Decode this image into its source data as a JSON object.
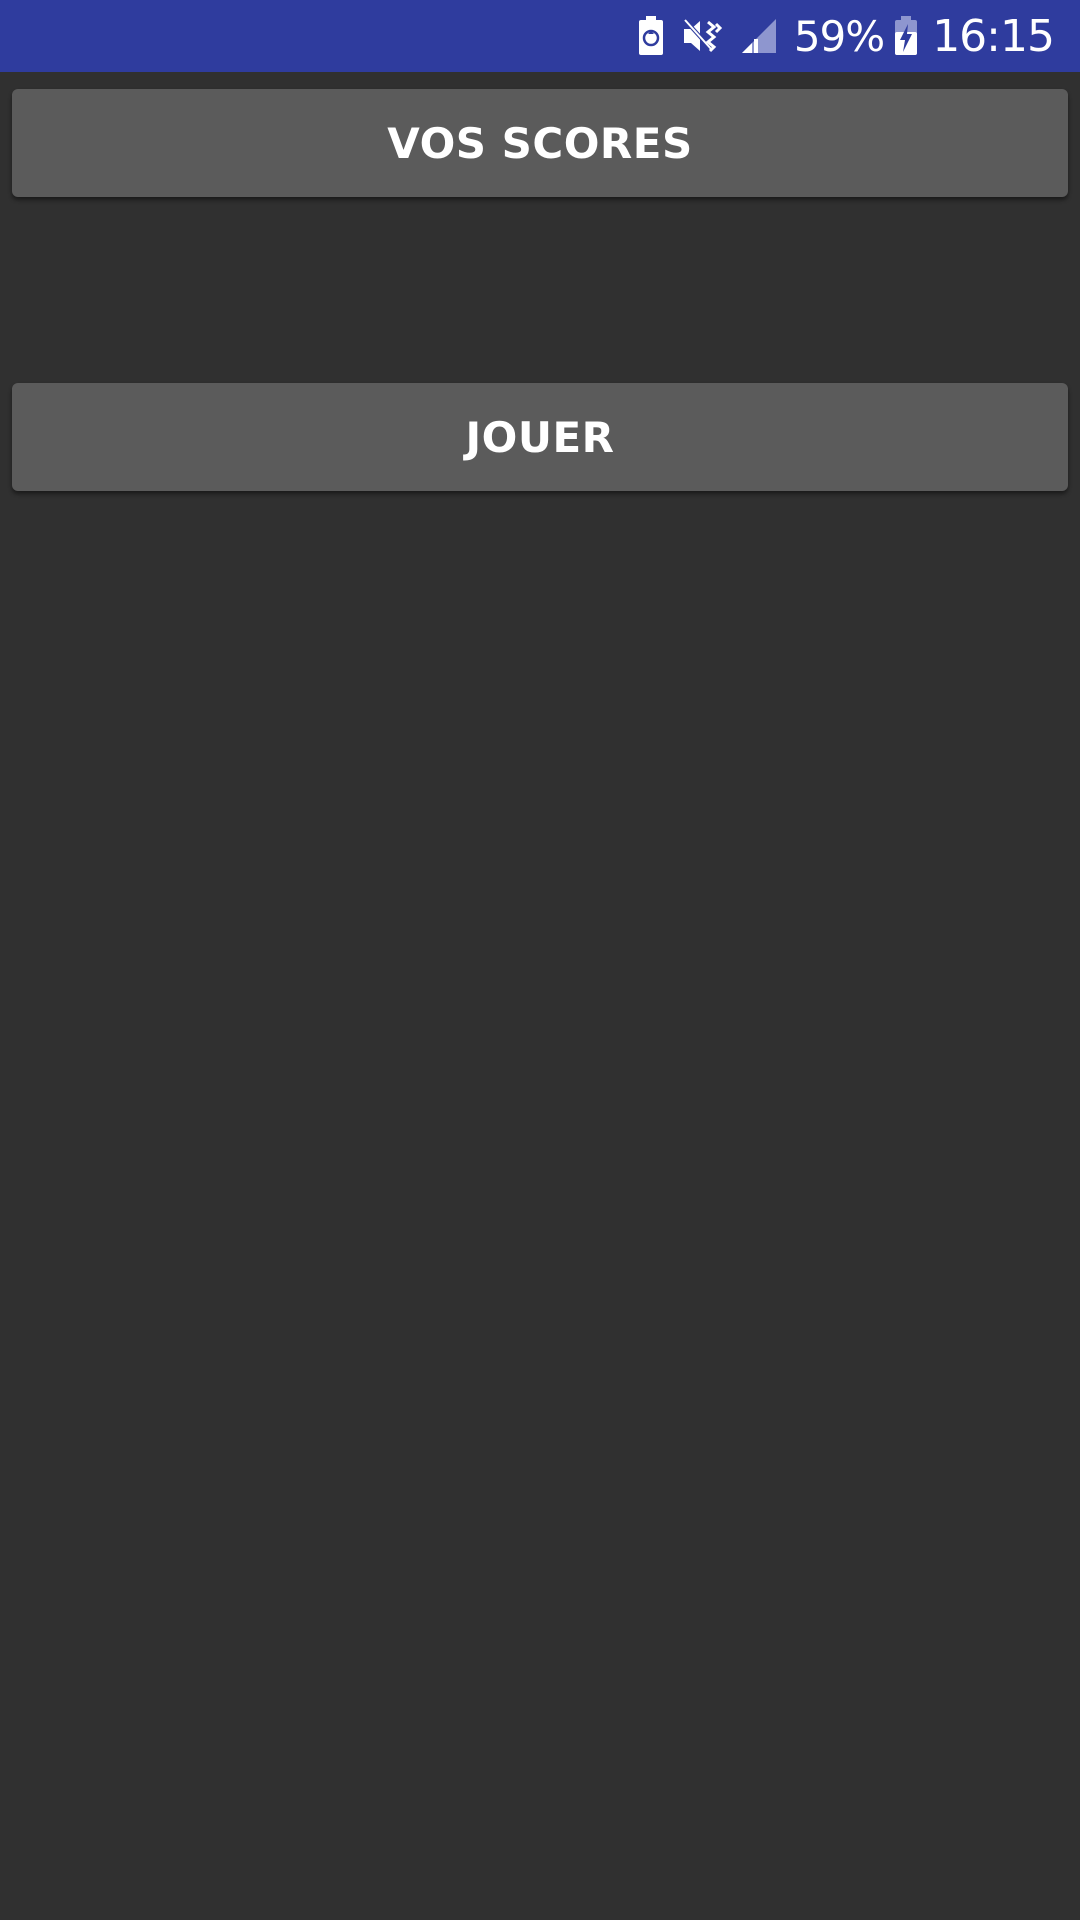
{
  "status_bar": {
    "battery_percent": "59%",
    "time": "16:15",
    "icons": [
      "battery-saver-icon",
      "vibrate-mute-icon",
      "signal-icon",
      "battery-charging-icon"
    ],
    "background_color": "#2f3c9e"
  },
  "buttons": {
    "scores_label": "VOS SCORES",
    "play_label": "JOUER"
  },
  "colors": {
    "background": "#303030",
    "button": "#5b5b5b",
    "text": "#ffffff"
  }
}
